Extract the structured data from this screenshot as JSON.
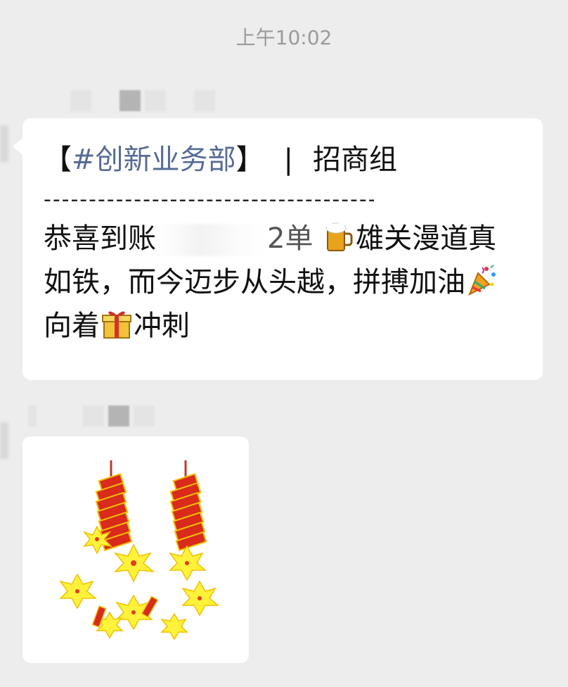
{
  "chat": {
    "timestamp": "上午10:02",
    "message1": {
      "bracket_open": "【",
      "tag": "#创新业务部",
      "bracket_close": "】",
      "separator": "|",
      "group": "招商组",
      "divider": "-----------------------------------------------------",
      "text_before_redaction": "恭喜到账",
      "text_after_redaction": "2单",
      "emoji_1": "beer-mug-icon",
      "text_mid": "雄关漫道真如铁，而今迈步从头越，拼搏加油",
      "emoji_2": "party-popper-icon",
      "text_after_party": "向着",
      "emoji_3": "gift-icon",
      "text_end": "冲刺"
    },
    "message2": {
      "image": "firecrackers-sticker"
    }
  },
  "colors": {
    "background": "#ededed",
    "bubble": "#ffffff",
    "link_blue": "#576b95",
    "timestamp_gray": "#9b9b9b"
  }
}
